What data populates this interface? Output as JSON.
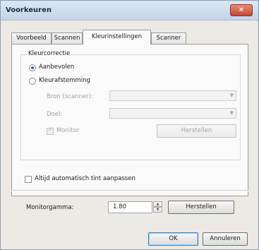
{
  "window": {
    "title": "Voorkeuren",
    "close_glyph": "✕"
  },
  "tabs": [
    {
      "label": "Voorbeeld"
    },
    {
      "label": "Scannen"
    },
    {
      "label": "Kleurinstellingen",
      "active": true
    },
    {
      "label": "Scanner"
    }
  ],
  "color_correction": {
    "legend": "Kleurcorrectie",
    "recommended_label": "Aanbevolen",
    "matching_label": "Kleurafstemming",
    "selected": "Aanbevolen",
    "source_label": "Bron (scanner):",
    "source_value": "",
    "target_label": "Doel:",
    "target_value": "",
    "monitor_label": "Monitor",
    "monitor_checked": true,
    "reset_label": "Herstellen"
  },
  "auto_tint": {
    "label": "Altijd automatisch tint aanpassen",
    "checked": false
  },
  "monitor_gamma": {
    "label": "Monitorgamma:",
    "value": "1.80",
    "reset_label": "Herstellen"
  },
  "footer": {
    "ok_label": "OK",
    "cancel_label": "Annuleren"
  }
}
